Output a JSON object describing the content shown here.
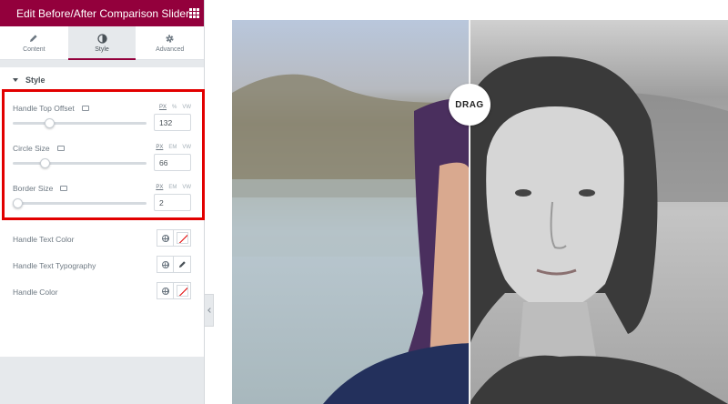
{
  "panel": {
    "title": "Edit Before/After Comparison Slider",
    "tabs": [
      {
        "label": "Content",
        "icon": "pencil-icon"
      },
      {
        "label": "Style",
        "icon": "contrast-icon"
      },
      {
        "label": "Advanced",
        "icon": "gear-icon"
      }
    ],
    "active_tab": "Style",
    "section_title": "Style",
    "sliders": [
      {
        "label": "Handle Top Offset",
        "units": [
          "PX",
          "%",
          "VW"
        ],
        "selected_unit": "PX",
        "value": "132",
        "level": 0.26
      },
      {
        "label": "Circle Size",
        "units": [
          "PX",
          "EM",
          "VW"
        ],
        "selected_unit": "PX",
        "value": "66",
        "level": 0.22
      },
      {
        "label": "Border Size",
        "units": [
          "PX",
          "EM",
          "VW"
        ],
        "selected_unit": "PX",
        "value": "2",
        "level": 0.0
      }
    ],
    "color_rows": [
      {
        "label": "Handle Text Color",
        "button": "no-color-swatch"
      },
      {
        "label": "Handle Text Typography",
        "button": "pencil-icon"
      },
      {
        "label": "Handle Color",
        "button": "no-color-swatch"
      }
    ]
  },
  "preview": {
    "handle_text": "DRAG"
  },
  "colors": {
    "brand": "#93003c",
    "highlight": "#e20000",
    "panel_bg": "#e6e9ec"
  }
}
